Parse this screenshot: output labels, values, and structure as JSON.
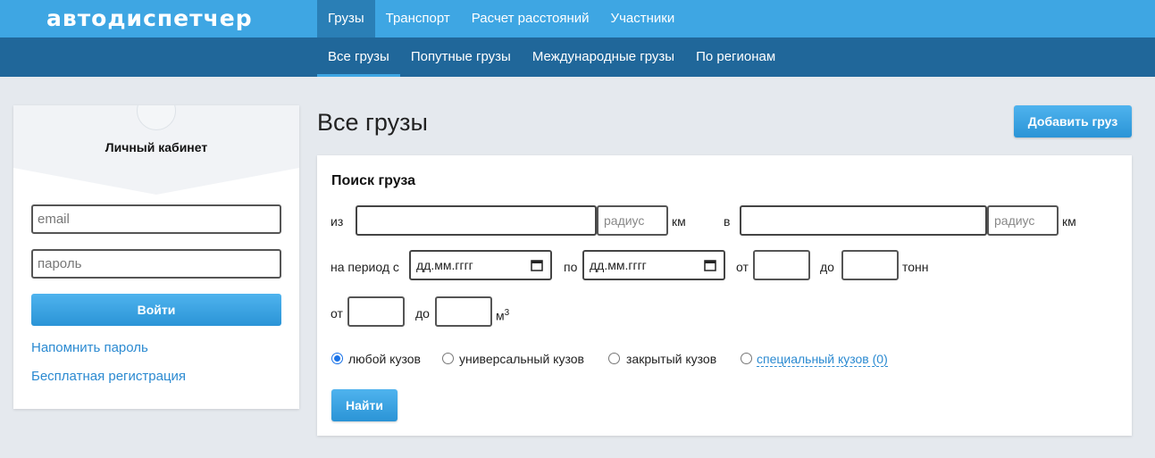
{
  "header": {
    "logo": "автодиспетчер",
    "nav": [
      "Грузы",
      "Транспорт",
      "Расчет расстояний",
      "Участники"
    ],
    "subnav": [
      "Все грузы",
      "Попутные грузы",
      "Международные грузы",
      "По регионам"
    ]
  },
  "sidebar": {
    "title": "Личный кабинет",
    "email_placeholder": "email",
    "password_placeholder": "пароль",
    "login_button": "Войти",
    "remind_link": "Напомнить пароль",
    "register_link": "Бесплатная регистрация"
  },
  "main": {
    "title": "Все грузы",
    "add_button": "Добавить груз"
  },
  "search": {
    "title": "Поиск груза",
    "from_label": "из",
    "radius_placeholder": "радиус",
    "km": "км",
    "to_label": "в",
    "period_label": "на период с",
    "date_placeholder": "дд.мм.гггг",
    "period_to_label": "по",
    "weight_from": "от",
    "weight_to": "до",
    "weight_unit": "тонн",
    "volume_from": "от",
    "volume_to": "до",
    "volume_unit": "м",
    "volume_sup": "3",
    "body_types": [
      "любой кузов",
      "универсальный кузов",
      "закрытый кузов",
      "специальный кузов (0)"
    ],
    "selected_body": "любой кузов",
    "find_button": "Найти"
  },
  "colors": {
    "topbar": "#3ea6e3",
    "subbar": "#20679a",
    "active_nav": "#2a7fb6",
    "link": "#2b8ad1",
    "page_bg": "#e5e9ee"
  }
}
